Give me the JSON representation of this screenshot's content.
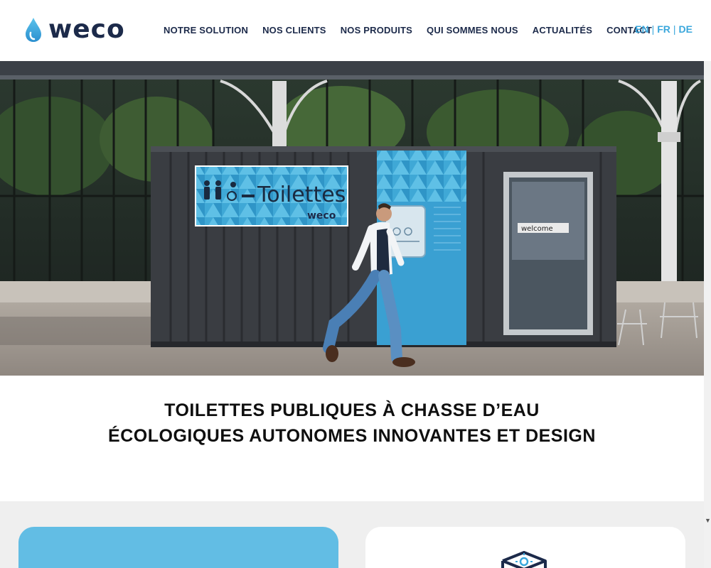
{
  "brand": {
    "logo_text": "weco"
  },
  "nav": {
    "items": [
      {
        "label": "NOTRE SOLUTION"
      },
      {
        "label": "NOS CLIENTS"
      },
      {
        "label": "NOS PRODUITS"
      },
      {
        "label": "QUI SOMMES NOUS"
      },
      {
        "label": "ACTUALITÉS"
      },
      {
        "label": "CONTACT"
      }
    ]
  },
  "languages": {
    "en": "EN",
    "fr": "FR",
    "de": "DE",
    "separator": "|"
  },
  "hero": {
    "sign_text": "Toilettes",
    "sign_brand": "weco",
    "door_text": "welcome"
  },
  "tagline": {
    "line1": "TOILETTES PUBLIQUES À CHASSE D’EAU",
    "line2": "ÉCOLOGIQUES AUTONOMES INNOVANTES ET DESIGN"
  },
  "colors": {
    "navy": "#1c2a4a",
    "accent_blue": "#3aa7dc",
    "card_blue": "#62bde4",
    "section_grey": "#efefef"
  },
  "icons": {
    "logo": "water-drop-icon",
    "card": "box-icon",
    "scroll": "chevron-down-icon"
  }
}
